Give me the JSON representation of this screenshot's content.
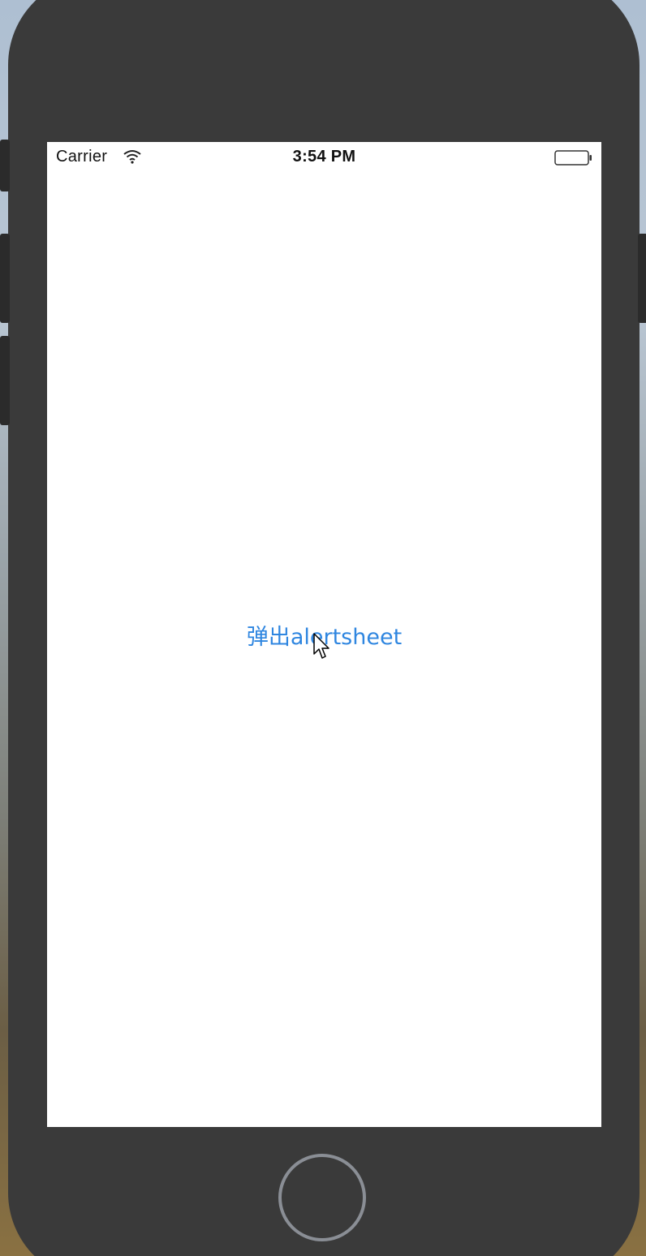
{
  "status_bar": {
    "carrier": "Carrier",
    "time": "3:54 PM",
    "wifi_icon": "wifi-icon",
    "battery_icon": "battery-icon"
  },
  "main": {
    "alert_button_label": "弹出alertsheet"
  },
  "hardware": {
    "home_button": "home-button-icon"
  },
  "colors": {
    "accent": "#2f86e0",
    "phone_body": "#3a3a3a",
    "screen_bg": "#ffffff"
  }
}
